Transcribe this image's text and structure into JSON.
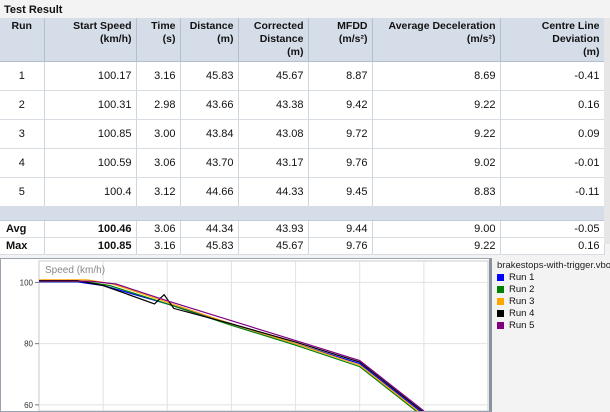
{
  "section_title": "Test Result",
  "table": {
    "headers": {
      "run": "Run",
      "start_speed": [
        "Start Speed",
        "(km/h)"
      ],
      "time": "Time (s)",
      "distance": "Distance (m)",
      "corrected": [
        "Corrected",
        "Distance (m)"
      ],
      "mfdd": "MFDD (m/s²)",
      "avg_decel": "Average Deceleration (m/s²)",
      "cld": [
        "Centre Line Deviation",
        "(m)"
      ]
    },
    "rows": [
      {
        "run": "1",
        "start_speed": "100.17",
        "time": "3.16",
        "distance": "45.83",
        "corrected": "45.67",
        "mfdd": "8.87",
        "avg_decel": "8.69",
        "cld": "-0.41"
      },
      {
        "run": "2",
        "start_speed": "100.31",
        "time": "2.98",
        "distance": "43.66",
        "corrected": "43.38",
        "mfdd": "9.42",
        "avg_decel": "9.22",
        "cld": "0.16"
      },
      {
        "run": "3",
        "start_speed": "100.85",
        "time": "3.00",
        "distance": "43.84",
        "corrected": "43.08",
        "mfdd": "9.72",
        "avg_decel": "9.22",
        "cld": "0.09"
      },
      {
        "run": "4",
        "start_speed": "100.59",
        "time": "3.06",
        "distance": "43.70",
        "corrected": "43.17",
        "mfdd": "9.76",
        "avg_decel": "9.02",
        "cld": "-0.01"
      },
      {
        "run": "5",
        "start_speed": "100.4",
        "time": "3.12",
        "distance": "44.66",
        "corrected": "44.33",
        "mfdd": "9.45",
        "avg_decel": "8.83",
        "cld": "-0.11"
      }
    ],
    "summary": [
      {
        "run": "Avg",
        "start_speed": "100.46",
        "time": "3.06",
        "distance": "44.34",
        "corrected": "43.93",
        "mfdd": "9.44",
        "avg_decel": "9.00",
        "cld": "-0.05"
      },
      {
        "run": "Max",
        "start_speed": "100.85",
        "time": "3.16",
        "distance": "45.83",
        "corrected": "45.67",
        "mfdd": "9.76",
        "avg_decel": "9.22",
        "cld": "0.16"
      }
    ]
  },
  "chart_data": {
    "type": "line",
    "ylabel": "Speed (km/h)",
    "yticks": [
      "100",
      "80",
      "60"
    ],
    "y_visible_range": [
      58,
      107
    ],
    "series": [
      {
        "name": "Run 1",
        "color": "#0000ff",
        "x": [
          0,
          0.12,
          0.2,
          0.4,
          0.6,
          0.8,
          1.0,
          1.2
        ],
        "y": [
          100.17,
          100.17,
          99,
          93,
          86.5,
          80,
          73.5,
          57
        ]
      },
      {
        "name": "Run 2",
        "color": "#008000",
        "x": [
          0,
          0.14,
          0.22,
          0.4,
          0.6,
          0.8,
          1.0,
          1.2
        ],
        "y": [
          100.31,
          100.31,
          99,
          93,
          86,
          79.5,
          72.5,
          56
        ]
      },
      {
        "name": "Run 3",
        "color": "#ffa500",
        "x": [
          0,
          0.15,
          0.23,
          0.4,
          0.6,
          0.8,
          1.0,
          1.2
        ],
        "y": [
          100.85,
          100.85,
          99.5,
          93.5,
          86.5,
          80,
          73,
          56.5
        ]
      },
      {
        "name": "Run 4",
        "color": "#000000",
        "x": [
          0,
          0.12,
          0.2,
          0.36,
          0.39,
          0.42,
          0.6,
          0.8,
          1.0,
          1.2
        ],
        "y": [
          100.59,
          100.59,
          99,
          93,
          96,
          91.5,
          86.5,
          80.5,
          74,
          57.5
        ]
      },
      {
        "name": "Run 5",
        "color": "#800080",
        "x": [
          0,
          0.16,
          0.24,
          0.4,
          0.6,
          0.8,
          1.0,
          1.2
        ],
        "y": [
          100.4,
          100.4,
          99.5,
          94,
          87.5,
          81,
          74.5,
          58
        ]
      }
    ],
    "legend_file": "brakestops-with-trigger.vbo",
    "grid": true
  }
}
